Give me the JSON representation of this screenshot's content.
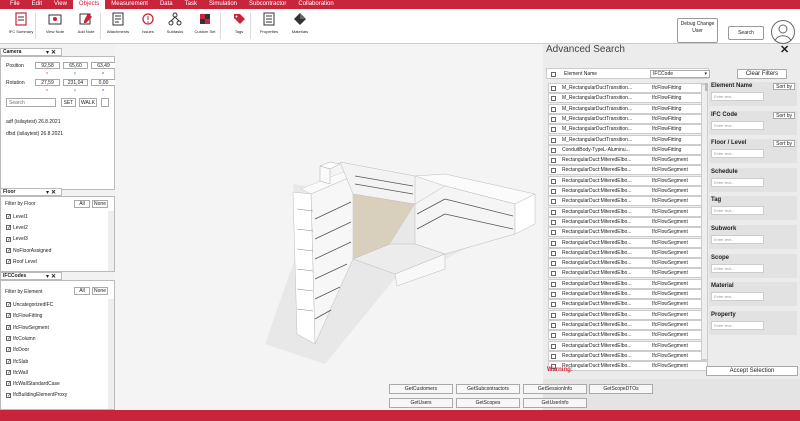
{
  "menu": [
    "File",
    "Edit",
    "View",
    "Objects",
    "Measurement",
    "Data",
    "Task",
    "Simulation",
    "Subcontractor",
    "Collaboration"
  ],
  "menu_active": "Objects",
  "toolbar": [
    {
      "label": "IFC Summary",
      "icon": "summary-icon"
    },
    {
      "label": "View Note",
      "icon": "view-note-icon"
    },
    {
      "label": "Add Note",
      "icon": "add-note-icon"
    },
    {
      "label": "Attachments",
      "icon": "attachment-icon"
    },
    {
      "label": "Issues",
      "icon": "issues-icon"
    },
    {
      "label": "Subtasks",
      "icon": "subtasks-icon"
    },
    {
      "label": "Custom Set",
      "icon": "custom-set-icon"
    },
    {
      "label": "Tags",
      "icon": "tag-icon"
    },
    {
      "label": "Properties",
      "icon": "properties-icon"
    },
    {
      "label": "Materials",
      "icon": "materials-icon"
    }
  ],
  "debug_button": "Debug Change User",
  "search_button": "Search",
  "camera": {
    "title": "Camera",
    "position_label": "Position",
    "position": [
      "92,58",
      "65,60",
      "63,49"
    ],
    "rotation_label": "Rotation",
    "rotation": [
      "27,59",
      "231,04",
      "0,00"
    ],
    "axis": [
      "x",
      "y",
      "z"
    ],
    "search_placeholder": "Search",
    "set_label": "SET",
    "walk_label": "WALK",
    "notes": [
      "adf  (isilaytest)  26.8.2021",
      "dfsd  (isilaytest)  26.8.2021"
    ]
  },
  "floor": {
    "title": "Floor",
    "filter_label": "Filter by Floor",
    "all": "All",
    "none": "None",
    "items": [
      "Level1",
      "Level2",
      "Level3",
      "NoFloorAssigned",
      "Roof Level"
    ]
  },
  "ifccodes": {
    "title": "IFCCodes",
    "filter_label": "Filter by Element",
    "all": "All",
    "none": "None",
    "items": [
      "UncategorizedIFC",
      "IfcFlowFitting",
      "IfcFlowSegment",
      "IfcColumn",
      "IfcDoor",
      "IfcSlab",
      "IfcWall",
      "IfcWallStandardCase",
      "IfcBuildingElementProxy"
    ]
  },
  "advanced_search": {
    "title": "Advanced Search",
    "col_element": "Element Name",
    "col_ifc": "IFCCode",
    "clear_filters": "Clear Filters",
    "rows": [
      [
        "M_RectangularDuctTransition...",
        "IfcFlowFitting"
      ],
      [
        "M_RectangularDuctTransition...",
        "IfcFlowFitting"
      ],
      [
        "M_RectangularDuctTransition...",
        "IfcFlowFitting"
      ],
      [
        "M_RectangularDuctTransition...",
        "IfcFlowFitting"
      ],
      [
        "M_RectangularDuctTransition...",
        "IfcFlowFitting"
      ],
      [
        "M_RectangularDuctTransition...",
        "IfcFlowFitting"
      ],
      [
        "ConduitBody-TypeL-Aluminu...",
        "IfcFlowFitting"
      ],
      [
        "RectangularDuct:MiteredElbo...",
        "IfcFlowSegment"
      ],
      [
        "RectangularDuct:MiteredElbo...",
        "IfcFlowSegment"
      ],
      [
        "RectangularDuct:MiteredElbo...",
        "IfcFlowSegment"
      ],
      [
        "RectangularDuct:MiteredElbo...",
        "IfcFlowSegment"
      ],
      [
        "RectangularDuct:MiteredElbo...",
        "IfcFlowSegment"
      ],
      [
        "RectangularDuct:MiteredElbo...",
        "IfcFlowSegment"
      ],
      [
        "RectangularDuct:MiteredElbo...",
        "IfcFlowSegment"
      ],
      [
        "RectangularDuct:MiteredElbo...",
        "IfcFlowSegment"
      ],
      [
        "RectangularDuct:MiteredElbo...",
        "IfcFlowSegment"
      ],
      [
        "RectangularDuct:MiteredElbo...",
        "IfcFlowSegment"
      ],
      [
        "RectangularDuct:MiteredElbo...",
        "IfcFlowSegment"
      ],
      [
        "RectangularDuct:MiteredElbo...",
        "IfcFlowSegment"
      ],
      [
        "RectangularDuct:MiteredElbo...",
        "IfcFlowSegment"
      ],
      [
        "RectangularDuct:MiteredElbo...",
        "IfcFlowSegment"
      ],
      [
        "RectangularDuct:MiteredElbo...",
        "IfcFlowSegment"
      ],
      [
        "RectangularDuct:MiteredElbo...",
        "IfcFlowSegment"
      ],
      [
        "RectangularDuct:MiteredElbo...",
        "IfcFlowSegment"
      ],
      [
        "RectangularDuct:MiteredElbo...",
        "IfcFlowSegment"
      ],
      [
        "RectangularDuct:MiteredElbo...",
        "IfcFlowSegment"
      ],
      [
        "RectangularDuct:MiteredElbo...",
        "IfcFlowSegment"
      ],
      [
        "RectangularDuct:MiteredElbo...",
        "IfcFlowSegment"
      ]
    ],
    "warning": "Warning:",
    "accept": "Accept Selection",
    "filters": [
      {
        "title": "Element Name",
        "sort": "Sort by",
        "placeholder": "Enter text..."
      },
      {
        "title": "IFC Code",
        "sort": "Sort by",
        "placeholder": "Enter text..."
      },
      {
        "title": "Floor / Level",
        "sort": "Sort by",
        "placeholder": "Enter text..."
      },
      {
        "title": "Schedule",
        "sort": "",
        "placeholder": "Enter text..."
      },
      {
        "title": "Tag",
        "sort": "",
        "placeholder": "Enter text..."
      },
      {
        "title": "Subwork",
        "sort": "",
        "placeholder": "Enter text..."
      },
      {
        "title": "Scope",
        "sort": "",
        "placeholder": "Enter text..."
      },
      {
        "title": "Material",
        "sort": "",
        "placeholder": "Enter text..."
      },
      {
        "title": "Property",
        "sort": "",
        "placeholder": "Enter text..."
      }
    ]
  },
  "api_buttons": [
    "GetCustomers",
    "GetSubcontractors",
    "GetSessionInfo",
    "GetScopeDTOs",
    "GetUsers",
    "GetScopes",
    "GetUserInfo"
  ],
  "colors": {
    "brand": "#c8253c"
  }
}
